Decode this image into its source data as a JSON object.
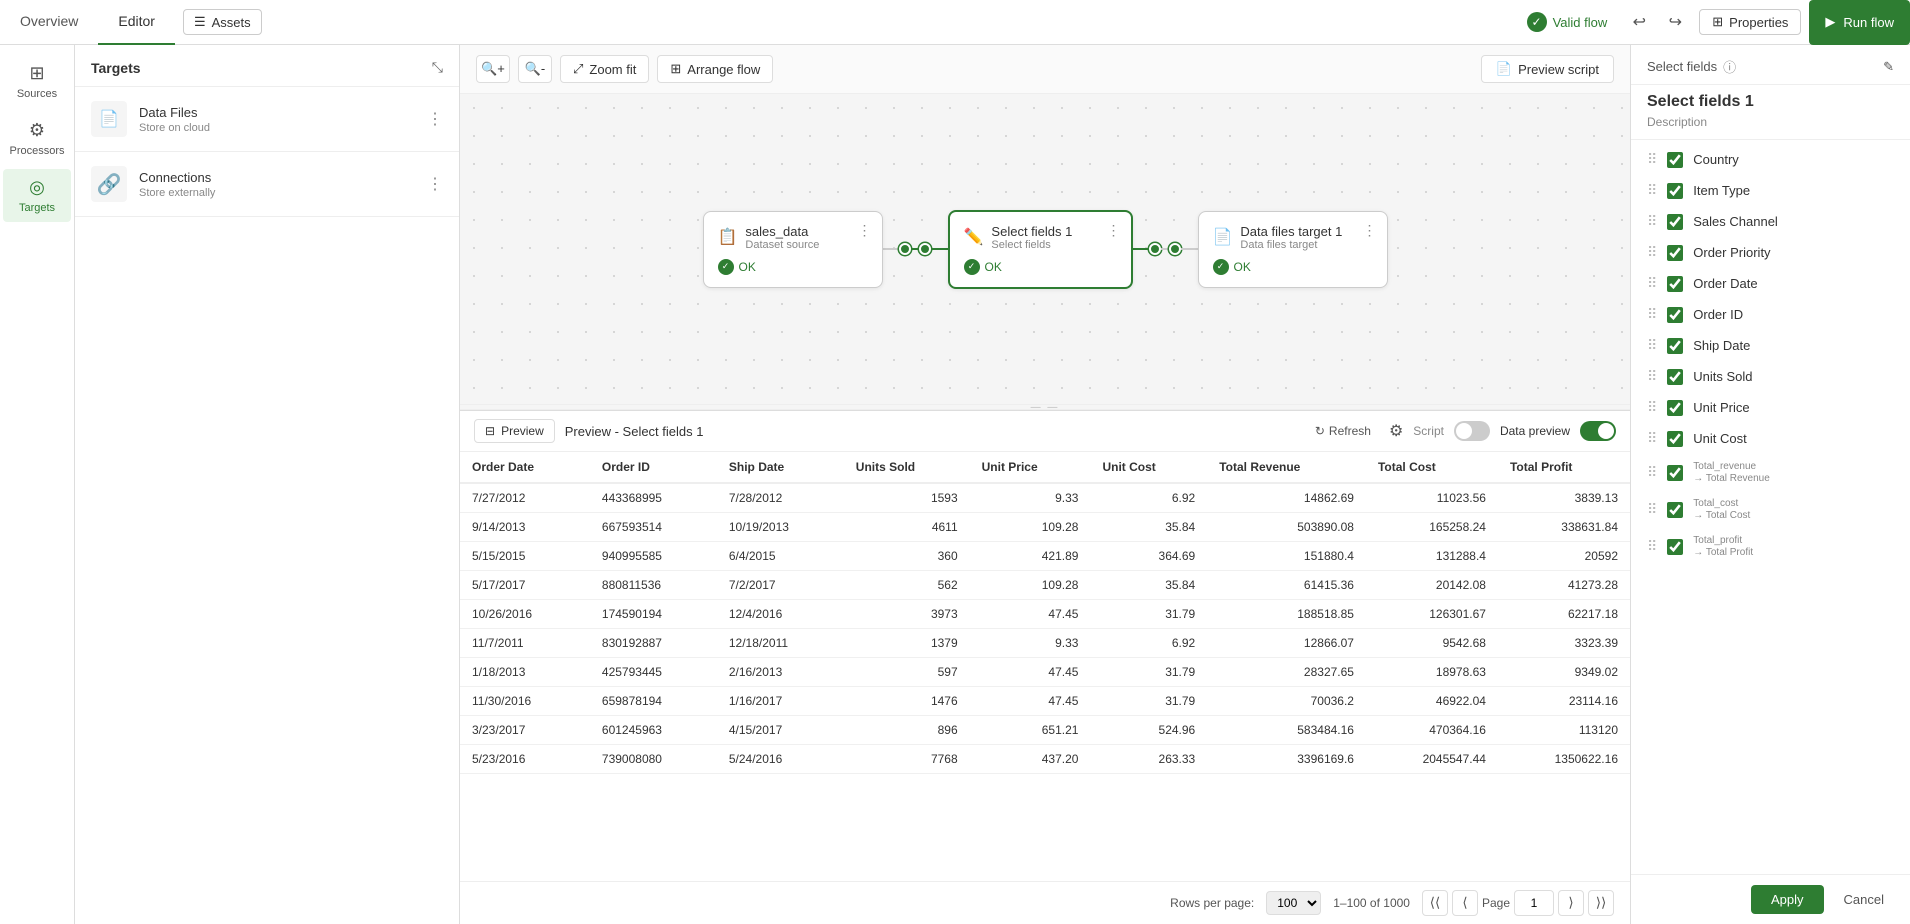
{
  "topNav": {
    "tabs": [
      {
        "id": "overview",
        "label": "Overview"
      },
      {
        "id": "editor",
        "label": "Editor"
      }
    ],
    "activeTab": "editor",
    "assetsBtn": "Assets",
    "validFlow": "Valid flow",
    "propertiesBtn": "Properties",
    "runBtn": "Run flow"
  },
  "sidebar": {
    "items": [
      {
        "id": "sources",
        "label": "Sources",
        "icon": "⊞"
      },
      {
        "id": "processors",
        "label": "Processors",
        "icon": "⚙"
      },
      {
        "id": "targets",
        "label": "Targets",
        "icon": "◎"
      }
    ],
    "activeItem": "targets"
  },
  "targetsPanel": {
    "title": "Targets",
    "items": [
      {
        "id": "data-files",
        "name": "Data Files",
        "sub": "Store on cloud",
        "icon": "📄"
      },
      {
        "id": "connections",
        "name": "Connections",
        "sub": "Store externally",
        "icon": "🔗"
      }
    ]
  },
  "canvasToolbar": {
    "zoomIn": "",
    "zoomOut": "",
    "zoomFit": "Zoom fit",
    "arrangeFlow": "Arrange flow",
    "previewScript": "Preview script"
  },
  "flowNodes": [
    {
      "id": "sales-data",
      "name": "sales_data",
      "type": "Dataset source",
      "status": "OK",
      "selected": false
    },
    {
      "id": "select-fields-1",
      "name": "Select fields 1",
      "type": "Select fields",
      "status": "OK",
      "selected": true
    },
    {
      "id": "data-files-target-1",
      "name": "Data files target 1",
      "type": "Data files target",
      "status": "OK",
      "selected": false
    }
  ],
  "preview": {
    "toggleLabel": "Preview",
    "title": "Preview - Select fields 1",
    "scriptLabel": "Script",
    "dataPreviewLabel": "Data preview",
    "refreshLabel": "Refresh",
    "rowsPerPageLabel": "Rows per page:",
    "rowsPerPageValue": "100",
    "pageInfoLabel": "1–100 of 1000",
    "pageLabel": "Page",
    "pageNum": "1",
    "columns": [
      "Order Date",
      "Order ID",
      "Ship Date",
      "Units Sold",
      "Unit Price",
      "Unit Cost",
      "Total Revenue",
      "Total Cost",
      "Total Profit"
    ],
    "rows": [
      [
        "7/27/2012",
        "443368995",
        "7/28/2012",
        "1593",
        "9.33",
        "6.92",
        "14862.69",
        "11023.56",
        "3839.13"
      ],
      [
        "9/14/2013",
        "667593514",
        "10/19/2013",
        "4611",
        "109.28",
        "35.84",
        "503890.08",
        "165258.24",
        "338631.84"
      ],
      [
        "5/15/2015",
        "940995585",
        "6/4/2015",
        "360",
        "421.89",
        "364.69",
        "151880.4",
        "131288.4",
        "20592"
      ],
      [
        "5/17/2017",
        "880811536",
        "7/2/2017",
        "562",
        "109.28",
        "35.84",
        "61415.36",
        "20142.08",
        "41273.28"
      ],
      [
        "10/26/2016",
        "174590194",
        "12/4/2016",
        "3973",
        "47.45",
        "31.79",
        "188518.85",
        "126301.67",
        "62217.18"
      ],
      [
        "11/7/2011",
        "830192887",
        "12/18/2011",
        "1379",
        "9.33",
        "6.92",
        "12866.07",
        "9542.68",
        "3323.39"
      ],
      [
        "1/18/2013",
        "425793445",
        "2/16/2013",
        "597",
        "47.45",
        "31.79",
        "28327.65",
        "18978.63",
        "9349.02"
      ],
      [
        "11/30/2016",
        "659878194",
        "1/16/2017",
        "1476",
        "47.45",
        "31.79",
        "70036.2",
        "46922.04",
        "23114.16"
      ],
      [
        "3/23/2017",
        "601245963",
        "4/15/2017",
        "896",
        "651.21",
        "524.96",
        "583484.16",
        "470364.16",
        "113120"
      ],
      [
        "5/23/2016",
        "739008080",
        "5/24/2016",
        "7768",
        "437.20",
        "263.33",
        "3396169.6",
        "2045547.44",
        "1350622.16"
      ]
    ]
  },
  "rightPanel": {
    "headerTitle": "Select fields",
    "subtitle": "Select fields 1",
    "description": "Description",
    "editIcon": "✎",
    "infoIcon": "ⓘ",
    "fields": [
      {
        "id": "country",
        "label": "Country",
        "checked": true,
        "mapped": false
      },
      {
        "id": "item-type",
        "label": "Item Type",
        "checked": true,
        "mapped": false
      },
      {
        "id": "sales-channel",
        "label": "Sales Channel",
        "checked": true,
        "mapped": false
      },
      {
        "id": "order-priority",
        "label": "Order Priority",
        "checked": true,
        "mapped": false
      },
      {
        "id": "order-date",
        "label": "Order Date",
        "checked": true,
        "mapped": false
      },
      {
        "id": "order-id",
        "label": "Order ID",
        "checked": true,
        "mapped": false
      },
      {
        "id": "ship-date",
        "label": "Ship Date",
        "checked": true,
        "mapped": false
      },
      {
        "id": "units-sold",
        "label": "Units Sold",
        "checked": true,
        "mapped": false
      },
      {
        "id": "unit-price",
        "label": "Unit Price",
        "checked": true,
        "mapped": false
      },
      {
        "id": "unit-cost",
        "label": "Unit Cost",
        "checked": true,
        "mapped": false
      },
      {
        "id": "total-revenue",
        "label": "Total Revenue",
        "checked": true,
        "mapped": true,
        "oldName": "Total_revenue",
        "newName": "Total Revenue"
      },
      {
        "id": "total-cost",
        "label": "Total Cost",
        "checked": true,
        "mapped": true,
        "oldName": "Total_cost",
        "newName": "Total Cost"
      },
      {
        "id": "total-profit",
        "label": "Total Profit",
        "checked": true,
        "mapped": true,
        "oldName": "Total_profit",
        "newName": "Total Profit"
      }
    ],
    "applyBtn": "Apply",
    "cancelBtn": "Cancel"
  }
}
